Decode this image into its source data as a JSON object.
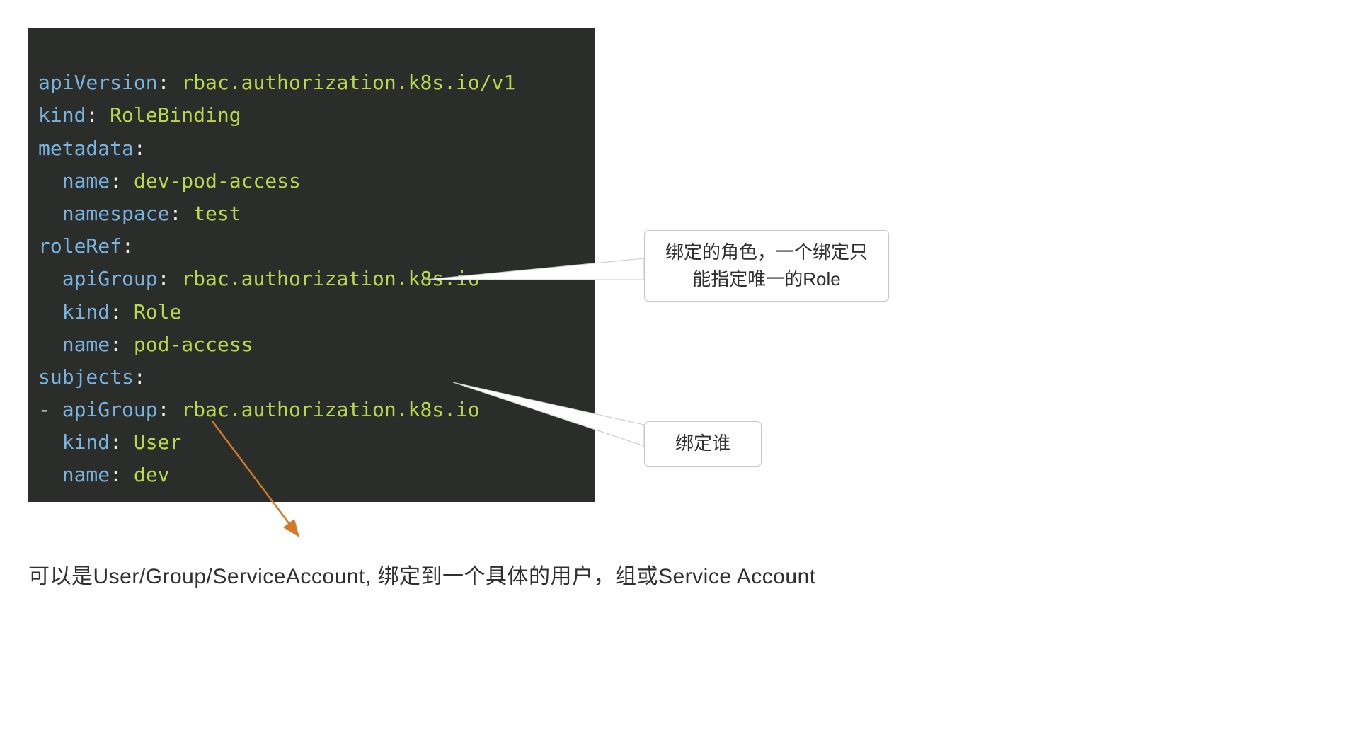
{
  "code": {
    "line1_key": "apiVersion",
    "line1_val": "rbac.authorization.k8s.io/v1",
    "line2_key": "kind",
    "line2_val": "RoleBinding",
    "line3_key": "metadata",
    "line4_key": "name",
    "line4_val": "dev-pod-access",
    "line5_key": "namespace",
    "line5_val": "test",
    "line6_key": "roleRef",
    "line7_key": "apiGroup",
    "line7_val": "rbac.authorization.k8s.io",
    "line8_key": "kind",
    "line8_val": "Role",
    "line9_key": "name",
    "line9_val": "pod-access",
    "line10_key": "subjects",
    "line11_dash": "-",
    "line11_key": "apiGroup",
    "line11_val": "rbac.authorization.k8s.io",
    "line12_key": "kind",
    "line12_val": "User",
    "line13_key": "name",
    "line13_val": "dev"
  },
  "callouts": {
    "c1": "绑定的角色，一个绑定只能指定唯一的Role",
    "c2": "绑定谁"
  },
  "caption": "可以是User/Group/ServiceAccount, 绑定到一个具体的用户，组或Service Account"
}
